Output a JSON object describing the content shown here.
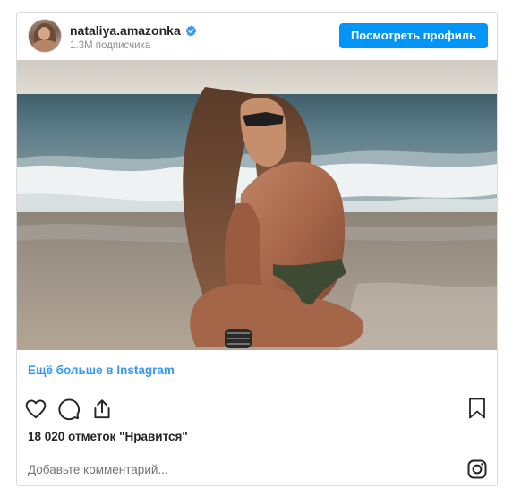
{
  "header": {
    "username": "nataliya.amazonka",
    "followers": "1.3M подписчика",
    "view_profile_label": "Посмотреть профиль",
    "verified_badge": "verified-badge-icon"
  },
  "post": {
    "more_link": "Ещё больше в Instagram",
    "likes": "18 020 отметок \"Нравится\"",
    "comment_placeholder": "Добавьте комментарий..."
  },
  "icons": {
    "like": "heart-icon",
    "comment": "comment-bubble-icon",
    "share": "share-icon",
    "save": "bookmark-icon",
    "brand": "instagram-glyph-icon"
  },
  "colors": {
    "accent": "#0095f6",
    "link": "#3897f0",
    "text": "#262626",
    "muted": "#8e8e8e",
    "border": "#dbdbdb"
  }
}
